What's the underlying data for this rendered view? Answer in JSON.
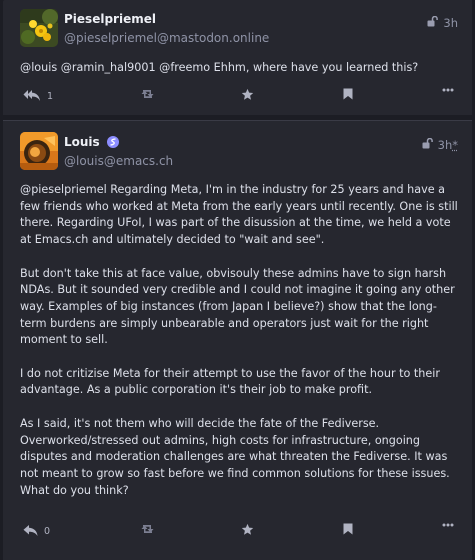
{
  "posts": [
    {
      "author": "Pieselpriemel",
      "handle": "@pieselpriemel@mastodon.online",
      "time": "3h",
      "text": "@louis @ramin_hal9001 @freemo Ehhm, where have you learned this?",
      "replies_count": "1",
      "icons": {
        "visibility": "unlock-icon",
        "reply": "reply-all-icon",
        "boost": "retweet-icon",
        "favourite": "star-icon",
        "bookmark": "bookmark-icon",
        "more": "more-icon"
      }
    },
    {
      "author": "Louis",
      "handle": "@louis@emacs.ch",
      "time": "3h",
      "edited_marker": "*",
      "paragraphs": [
        "@pieselpriemel Regarding Meta, I'm in the industry for 25 years and have a few friends who worked at Meta from the early years until recently. One is still there. Regarding UFoI, I was part of the disussion at the time, we held a vote at Emacs.ch and ultimately decided to \"wait and see\".",
        "But don't take this at face value, obvisouly these admins have to sign harsh NDAs. But it sounded very credible and I could not imagine it going any other way. Examples of big instances (from Japan I believe?) show that the long-term burdens are simply unbearable and operators just wait for the right moment to sell.",
        "I do not critizise Meta for their attempt to use the favor of the hour to their advantage.  As a public corporation it's their job to make profit.",
        "As I said, it's not them who will decide the fate of the Fediverse. Overworked/stressed out admins, high costs for infrastructure, ongoing disputes and moderation challenges are what threaten the Fediverse. It was not meant to grow so fast before we find common solutions for these issues. What do you think?"
      ],
      "replies_count": "0",
      "icons": {
        "badge": "emacs-badge-icon",
        "visibility": "unlock-icon",
        "reply": "reply-icon",
        "boost": "retweet-icon",
        "favourite": "star-icon",
        "bookmark": "bookmark-icon",
        "more": "more-icon"
      }
    }
  ],
  "colors": {
    "background": "#1c1d24",
    "card": "#26272f",
    "accent": "#8c8dff",
    "muted": "#8f93a6"
  }
}
